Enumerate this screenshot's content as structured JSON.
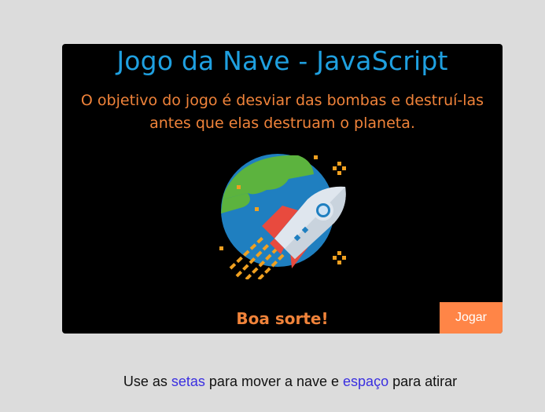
{
  "game": {
    "title": "Jogo da Nave - JavaScript",
    "objective": "O objetivo do jogo é desviar das bombas e destruí-las antes que elas destruam o planeta.",
    "good_luck": "Boa sorte!",
    "play_button": "Jogar",
    "illustration_icon": "rocket-planet-icon"
  },
  "instructions": {
    "part1": "Use as ",
    "arrows": "setas",
    "part2": " para mover a nave e ",
    "space": "espaço",
    "part3": " para atirar"
  },
  "colors": {
    "page_background": "#dcdcdc",
    "stage_background": "#000000",
    "title": "#1fa0e0",
    "accent_text": "#f0833a",
    "button": "#ff8547",
    "keyword": "#3a2fe0"
  }
}
